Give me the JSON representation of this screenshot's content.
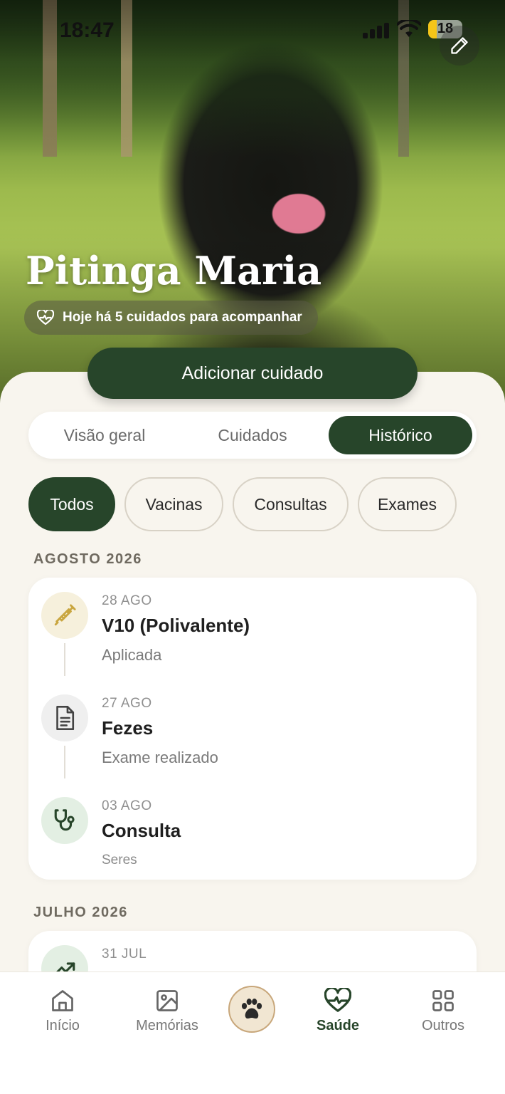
{
  "status_bar": {
    "time": "18:47",
    "battery_level": "18"
  },
  "pet": {
    "name": "Pitinga Maria",
    "care_summary": "Hoje há 5 cuidados para acompanhar"
  },
  "actions": {
    "add_care": "Adicionar cuidado"
  },
  "tabs": [
    {
      "label": "Visão geral",
      "active": false
    },
    {
      "label": "Cuidados",
      "active": false
    },
    {
      "label": "Histórico",
      "active": true
    }
  ],
  "filters": [
    {
      "label": "Todos",
      "active": true
    },
    {
      "label": "Vacinas",
      "active": false
    },
    {
      "label": "Consultas",
      "active": false
    },
    {
      "label": "Exames",
      "active": false
    }
  ],
  "history": [
    {
      "month": "AGOSTO 2026",
      "entries": [
        {
          "date": "28 AGO",
          "title": "V10 (Polivalente)",
          "subtitle": "Aplicada",
          "icon": "syringe-icon"
        },
        {
          "date": "27 AGO",
          "title": "Fezes",
          "subtitle": "Exame realizado",
          "icon": "document-icon"
        },
        {
          "date": "03 AGO",
          "title": "Consulta",
          "subtitle": "Seres",
          "icon": "stethoscope-icon"
        }
      ]
    },
    {
      "month": "JULHO 2026",
      "entries": [
        {
          "date": "31 JUL",
          "title": "",
          "subtitle": "",
          "icon": "trend-up-icon"
        }
      ]
    }
  ],
  "nav": [
    {
      "label": "Início",
      "icon": "home-icon",
      "active": false
    },
    {
      "label": "Memórias",
      "icon": "image-icon",
      "active": false
    },
    {
      "label": "",
      "icon": "paw-icon",
      "active": false
    },
    {
      "label": "Saúde",
      "icon": "heart-pulse-icon",
      "active": true
    },
    {
      "label": "Outros",
      "icon": "grid-icon",
      "active": false
    }
  ],
  "colors": {
    "primary": "#27452a",
    "background": "#f8f5ee",
    "vaccine_icon_bg": "#f6f0dc",
    "vaccine_icon": "#c9a640",
    "exam_icon_bg": "#efefef",
    "consult_icon_bg": "#e3efe3"
  }
}
